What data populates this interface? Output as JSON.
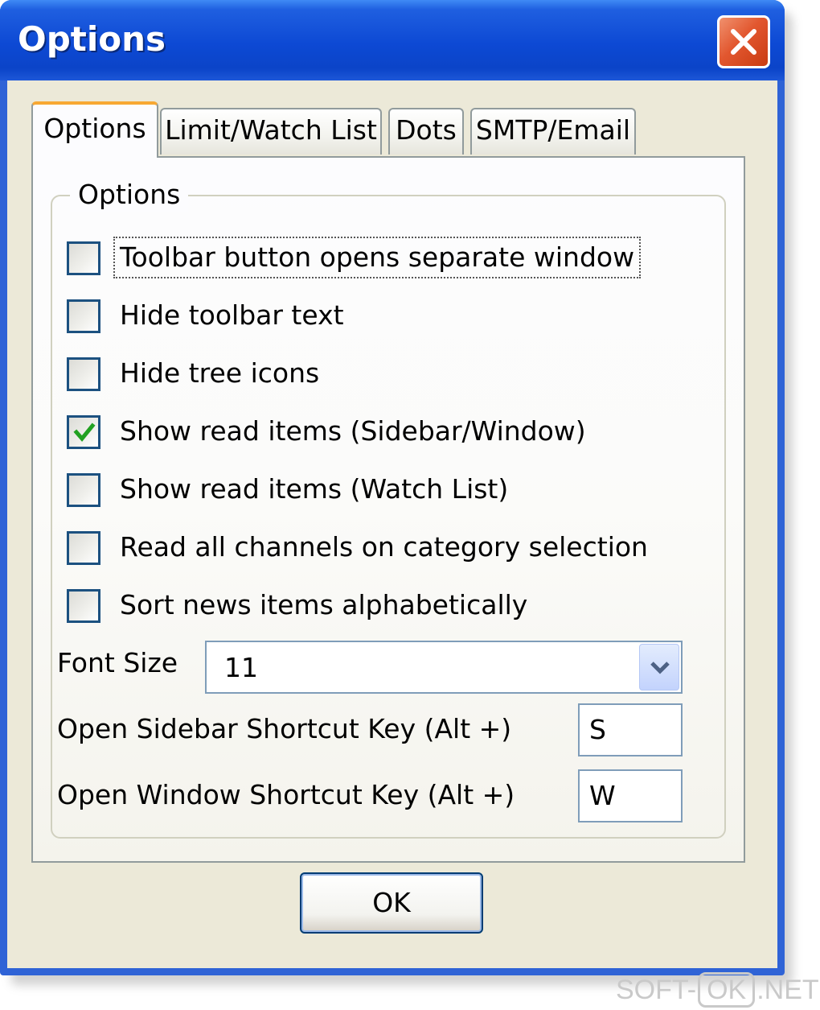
{
  "window": {
    "title": "Options"
  },
  "tabs": [
    {
      "label": "Options",
      "active": true
    },
    {
      "label": "Limit/Watch List",
      "active": false
    },
    {
      "label": "Dots",
      "active": false
    },
    {
      "label": "SMTP/Email",
      "active": false
    }
  ],
  "group": {
    "title": "Options"
  },
  "checkboxes": [
    {
      "label": "Toolbar button opens separate window",
      "checked": false
    },
    {
      "label": "Hide toolbar text",
      "checked": false
    },
    {
      "label": "Hide tree icons",
      "checked": false
    },
    {
      "label": "Show read items (Sidebar/Window)",
      "checked": true
    },
    {
      "label": "Show read items (Watch List)",
      "checked": false
    },
    {
      "label": "Read all channels on category selection",
      "checked": false
    },
    {
      "label": "Sort news items alphabetically",
      "checked": false
    }
  ],
  "font_size": {
    "label": "Font Size",
    "value": "11"
  },
  "sidebar_shortcut": {
    "label": "Open Sidebar Shortcut Key (Alt +)",
    "value": "S"
  },
  "window_shortcut": {
    "label": "Open Window Shortcut Key (Alt +)",
    "value": "W"
  },
  "ok_button": {
    "label": "OK"
  },
  "watermark": {
    "prefix": "SOFT-",
    "boxed": "OK",
    "suffix": ".NET"
  },
  "colors": {
    "titlebar": "#0b44c8",
    "close_button": "#e2572f",
    "active_tab_accent": "#f7a833",
    "checkmark": "#21a121",
    "dialog_background": "#ece9d8"
  },
  "icons": {
    "close": "close-icon",
    "check": "checkmark-icon",
    "dropdown": "chevron-down-icon"
  }
}
